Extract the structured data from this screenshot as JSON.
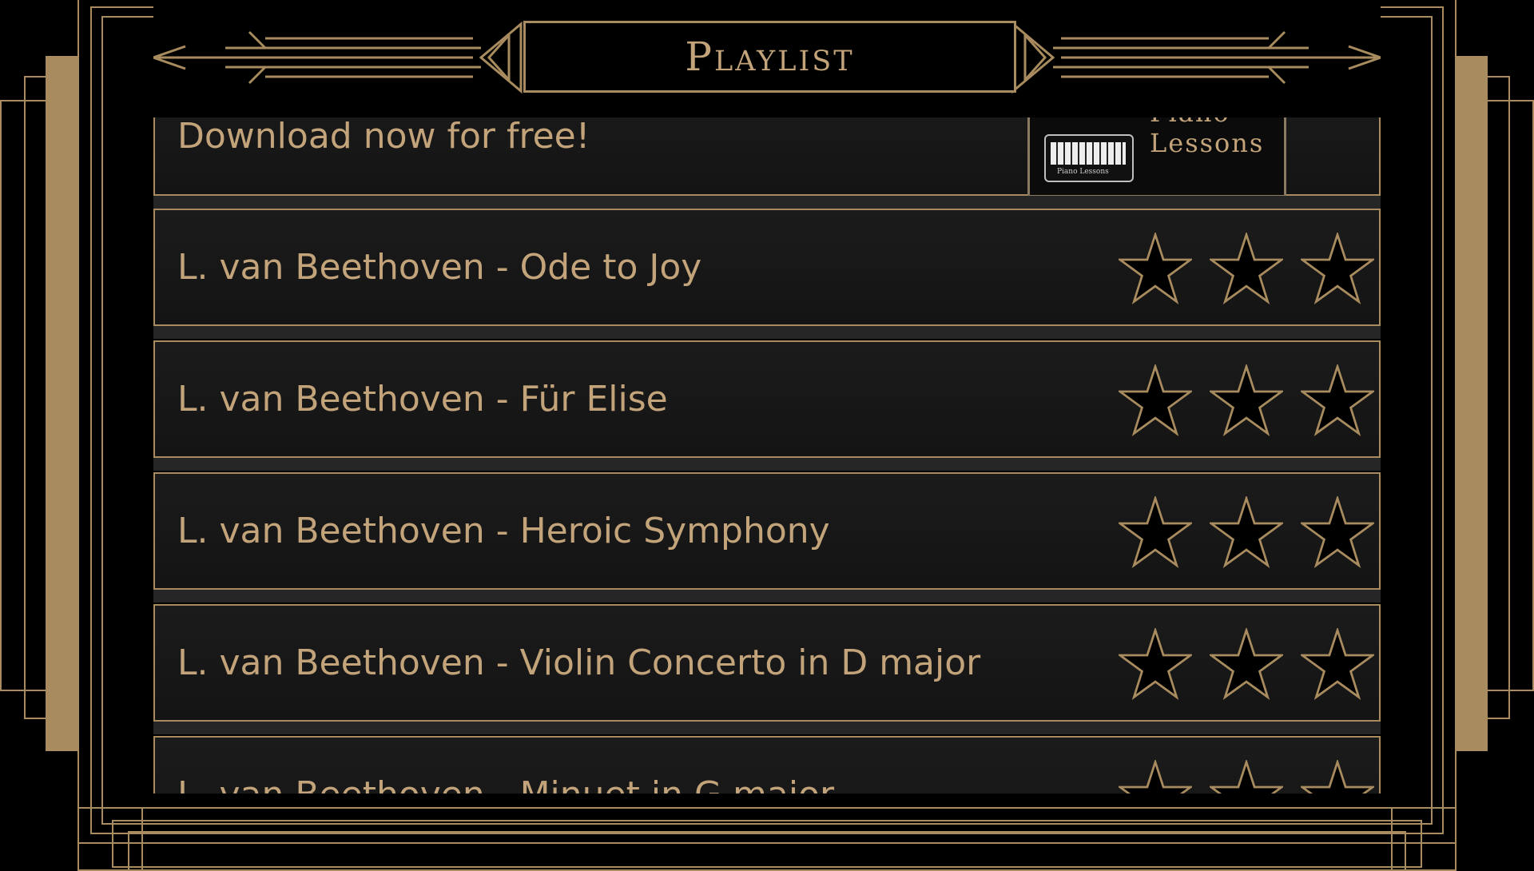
{
  "header": {
    "title": "Playlist"
  },
  "ad": {
    "text": "Download now for free!",
    "logo_line1": "Piano",
    "logo_line2": "Lessons",
    "logo_caption": "Piano Lessons"
  },
  "songs": [
    {
      "title": "L. van Beethoven - Ode to Joy",
      "stars_filled": 0,
      "stars_total": 3
    },
    {
      "title": "L. van Beethoven - Für Elise",
      "stars_filled": 0,
      "stars_total": 3
    },
    {
      "title": "L. van Beethoven - Heroic Symphony",
      "stars_filled": 0,
      "stars_total": 3
    },
    {
      "title": "L. van Beethoven - Violin Concerto in D major",
      "stars_filled": 0,
      "stars_total": 3
    },
    {
      "title": "L. van Beethoven - Minuet in G major",
      "stars_filled": 0,
      "stars_total": 3
    }
  ],
  "colors": {
    "gold": "#a88b5e",
    "text_gold": "#c2a37a",
    "background": "#000000",
    "row_bg": "#181818"
  },
  "icons": {
    "star": "star-outline-icon"
  }
}
